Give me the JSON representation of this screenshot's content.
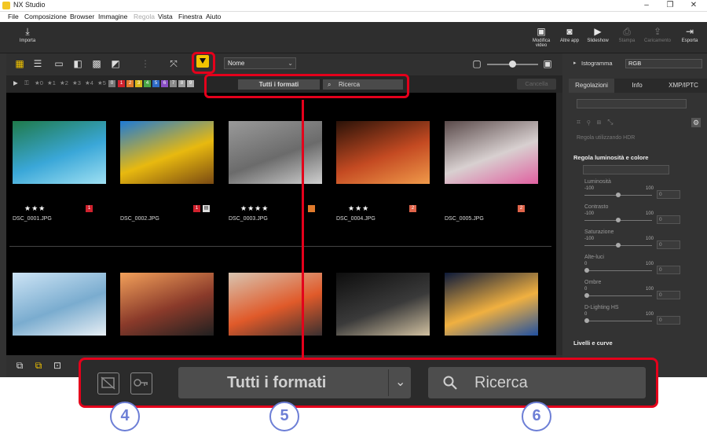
{
  "window": {
    "title": "NX Studio"
  },
  "menu": [
    "File",
    "Composizione",
    "Browser",
    "Immagine",
    "Regola",
    "Vista",
    "Finestra",
    "Aiuto"
  ],
  "toolbar": {
    "import": "Importa",
    "edit_video": "Modifica video",
    "other_apps": "Altre app",
    "slideshow": "Slideshow",
    "print": "Stampa",
    "upload": "Caricamento",
    "export": "Esporta"
  },
  "viewbar": {
    "sort": "Nome"
  },
  "filterbar": {
    "ratings": [
      "★0",
      "★1",
      "★2",
      "★3",
      "★4",
      "★5"
    ],
    "labels": [
      "0",
      "1",
      "2",
      "3",
      "4",
      "5",
      "6",
      "7",
      "8",
      "9"
    ],
    "label_colors": [
      "#777777",
      "#d0222e",
      "#e07a2c",
      "#d9b81d",
      "#4aa546",
      "#2f6cc8",
      "#8a4fc5",
      "#8a8a8a",
      "#9e9e9e",
      "#b0b0b0"
    ],
    "format": "Tutti i formati",
    "search": "Ricerca",
    "cancel": "Cancella"
  },
  "photos": [
    {
      "file": "DSC_0001.JPG",
      "stars": "★★★",
      "label": "1",
      "label_color": "#d0222e",
      "colors": [
        "#1f7a4a",
        "#3aa7d8",
        "#9fe0f2"
      ]
    },
    {
      "file": "DSC_0002.JPG",
      "stars": "",
      "label": "1",
      "label_color": "#d0222e",
      "colors": [
        "#1e7ad6",
        "#e8b90f",
        "#7a4a12"
      ]
    },
    {
      "file": "DSC_0003.JPG",
      "stars": "★★★★",
      "label": "",
      "label_color": "#e07a2c",
      "colors": [
        "#9a9a9a",
        "#6b6b6b",
        "#cfcfcf"
      ]
    },
    {
      "file": "DSC_0004.JPG",
      "stars": "★★★",
      "label": "2",
      "label_color": "#e0644a",
      "colors": [
        "#2a1208",
        "#c44a22",
        "#f09a4a"
      ]
    },
    {
      "file": "DSC_0005.JPG",
      "stars": "",
      "label": "2",
      "label_color": "#e0644a",
      "colors": [
        "#5a4a4a",
        "#d8d0d0",
        "#e060a0"
      ]
    },
    {
      "file": "",
      "stars": "",
      "label": "",
      "label_color": "",
      "colors": [
        "#cde4f5",
        "#7aaccf",
        "#e7eef4"
      ]
    },
    {
      "file": "",
      "stars": "",
      "label": "",
      "label_color": "",
      "colors": [
        "#f2a05a",
        "#8a3a2a",
        "#202020"
      ]
    },
    {
      "file": "",
      "stars": "",
      "label": "",
      "label_color": "",
      "colors": [
        "#d8c4b0",
        "#e05a2a",
        "#3a3030"
      ]
    },
    {
      "file": "",
      "stars": "",
      "label": "",
      "label_color": "",
      "colors": [
        "#0e0e0e",
        "#3a3a3a",
        "#d0c0a0"
      ]
    },
    {
      "file": "",
      "stars": "",
      "label": "",
      "label_color": "",
      "colors": [
        "#0d1a3a",
        "#f0b040",
        "#2050a0"
      ]
    }
  ],
  "right_panel": {
    "histogram": "Istogramma",
    "hist_mode": "RGB",
    "tabs": [
      "Regolazioni",
      "Info",
      "XMP/IPTC"
    ],
    "hdr": "Regola utilizzando HDR",
    "section1": "Regola luminosità e colore",
    "sliders": [
      {
        "name": "Luminosità",
        "min": "-100",
        "max": "100",
        "value": "0"
      },
      {
        "name": "Contrasto",
        "min": "-100",
        "max": "100",
        "value": "0"
      },
      {
        "name": "Saturazione",
        "min": "-100",
        "max": "100",
        "value": "0"
      },
      {
        "name": "Alte-luci",
        "min": "0",
        "max": "100",
        "value": "0"
      },
      {
        "name": "Ombre",
        "min": "0",
        "max": "100",
        "value": "0"
      },
      {
        "name": "D-Lighting HS",
        "min": "0",
        "max": "100",
        "value": "0"
      }
    ],
    "section2": "Livelli e curve"
  },
  "zoom": {
    "format": "Tutti i formati",
    "search": "Ricerca"
  },
  "callouts": [
    "4",
    "5",
    "6"
  ],
  "accent": "#e4001b",
  "callout_color": "#6d7fd6"
}
